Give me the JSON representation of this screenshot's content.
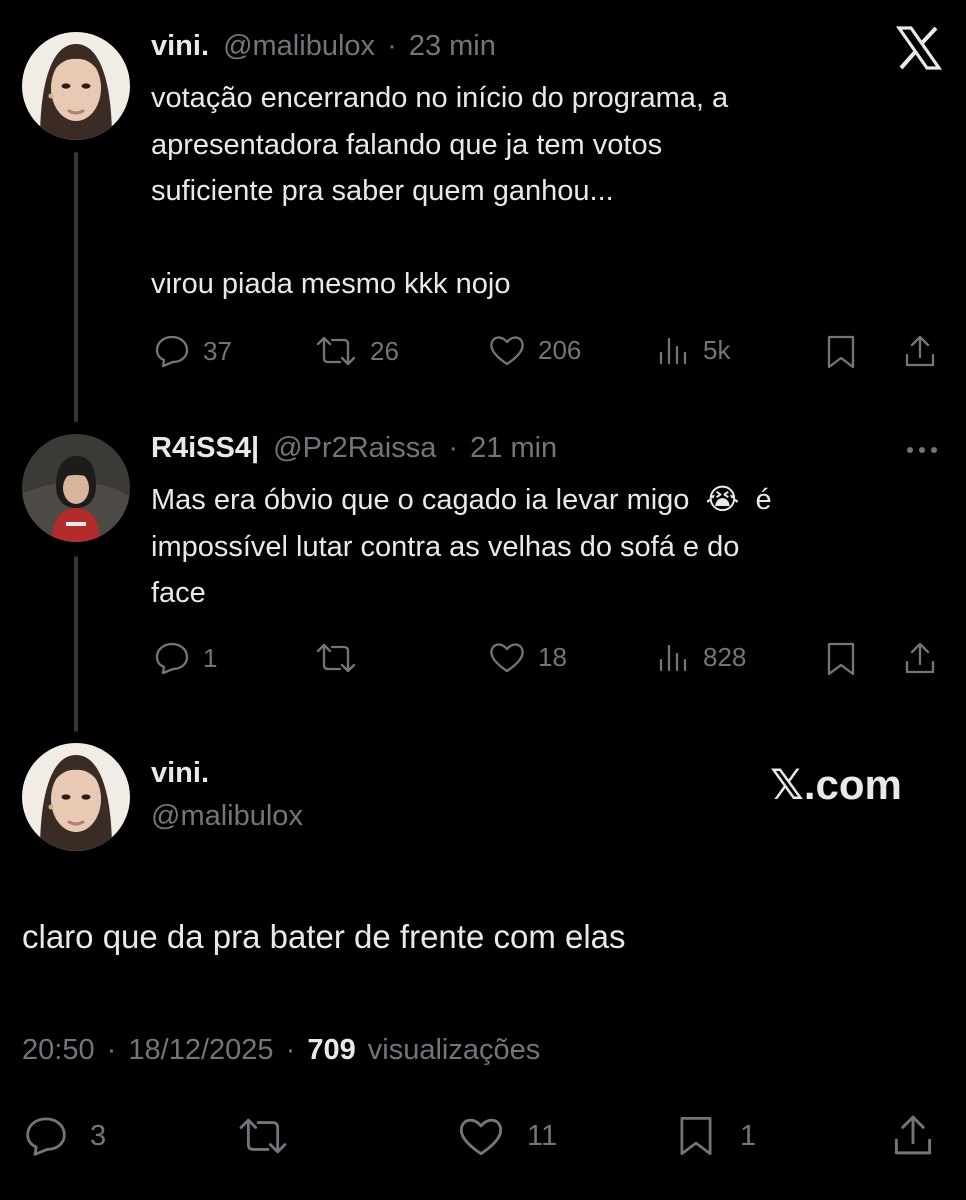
{
  "colors": {
    "background": "#000000",
    "text": "#e7e9ea",
    "muted": "#71767b",
    "thread_line": "#333639"
  },
  "brand": {
    "logo_icon": "x-logo-icon",
    "watermark": "𝕏.com"
  },
  "tweet1": {
    "name": "vini.",
    "handle": "@malibulox",
    "time": "23 min",
    "lines": [
      "votação encerrando no início do programa, a",
      "apresentadora falando que ja tem votos",
      "suficiente pra saber quem ganhou...",
      "virou piada mesmo kkk nojo"
    ],
    "actions": {
      "replies": "37",
      "retweets": "26",
      "likes": "206",
      "views": "5k"
    }
  },
  "tweet2": {
    "name": "R4iSS4|",
    "handle": "@Pr2Raissa",
    "time": "21 min",
    "lines": [
      "Mas era óbvio que o cagado ia levar migo",
      "é",
      "impossível lutar contra as velhas do sofá e do",
      "face"
    ],
    "emoji": "😭",
    "actions": {
      "replies": "1",
      "retweets": "",
      "likes": "18",
      "views": "828"
    }
  },
  "tweet3": {
    "name": "vini.",
    "handle": "@malibulox",
    "text": "claro que da pra bater de frente com elas",
    "time": "20:50",
    "date": "18/12/2025",
    "views_count": "709",
    "views_label": "visualizações",
    "separator": "·",
    "actions": {
      "replies": "3",
      "retweets": "",
      "likes": "11",
      "bookmarks": "1"
    }
  }
}
